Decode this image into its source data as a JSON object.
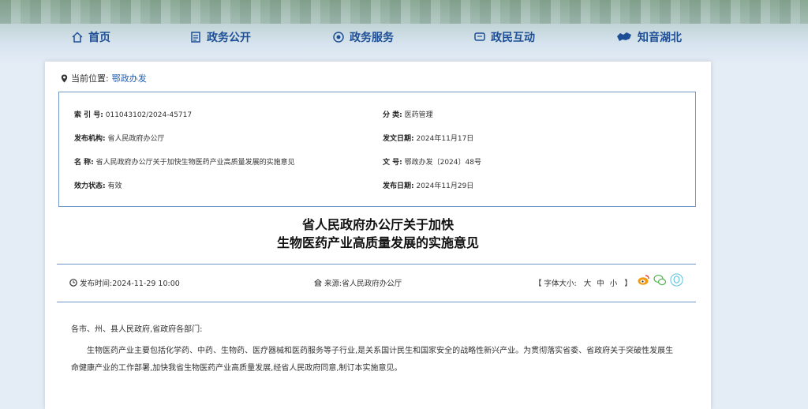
{
  "nav": {
    "home": "首页",
    "open": "政务公开",
    "service": "政务服务",
    "interact": "政民互动",
    "hubei": "知音湖北"
  },
  "breadcrumb": {
    "label": "当前位置:",
    "link": "鄂政办发"
  },
  "meta": {
    "index_label": "索 引 号:",
    "index_value": "011043102/2024-45717",
    "category_label": "分 类:",
    "category_value": "医药管理",
    "org_label": "发布机构:",
    "org_value": "省人民政府办公厅",
    "issue_date_label": "发文日期:",
    "issue_date_value": "2024年11月17日",
    "name_label": "名 称:",
    "name_value": "省人民政府办公厅关于加快生物医药产业高质量发展的实施意见",
    "docno_label": "文 号:",
    "docno_value": "鄂政办发〔2024〕48号",
    "status_label": "效力状态:",
    "status_value": "有效",
    "pub_date_label": "发布日期:",
    "pub_date_value": "2024年11月29日"
  },
  "title": {
    "line1": "省人民政府办公厅关于加快",
    "line2": "生物医药产业高质量发展的实施意见"
  },
  "info": {
    "time": "发布时间:2024-11-29 10:00",
    "source": "来源:省人民政府办公厅",
    "font_open": "【 字体大小:",
    "font_large": "大",
    "font_mid": "中",
    "font_small": "小",
    "font_close": "】"
  },
  "body": {
    "salutation": "各市、州、县人民政府,省政府各部门:",
    "para1": "生物医药产业主要包括化学药、中药、生物药、医疗器械和医药服务等子行业,是关系国计民生和国家安全的战略性新兴产业。为贯彻落实省委、省政府关于突破性发展生命健康产业的工作部署,加快我省生物医药产业高质量发展,经省人民政府同意,制订本实施意见。"
  },
  "colors": {
    "nav": "#1e4f96",
    "border": "#6f95c9",
    "link": "#1e5fb3"
  }
}
